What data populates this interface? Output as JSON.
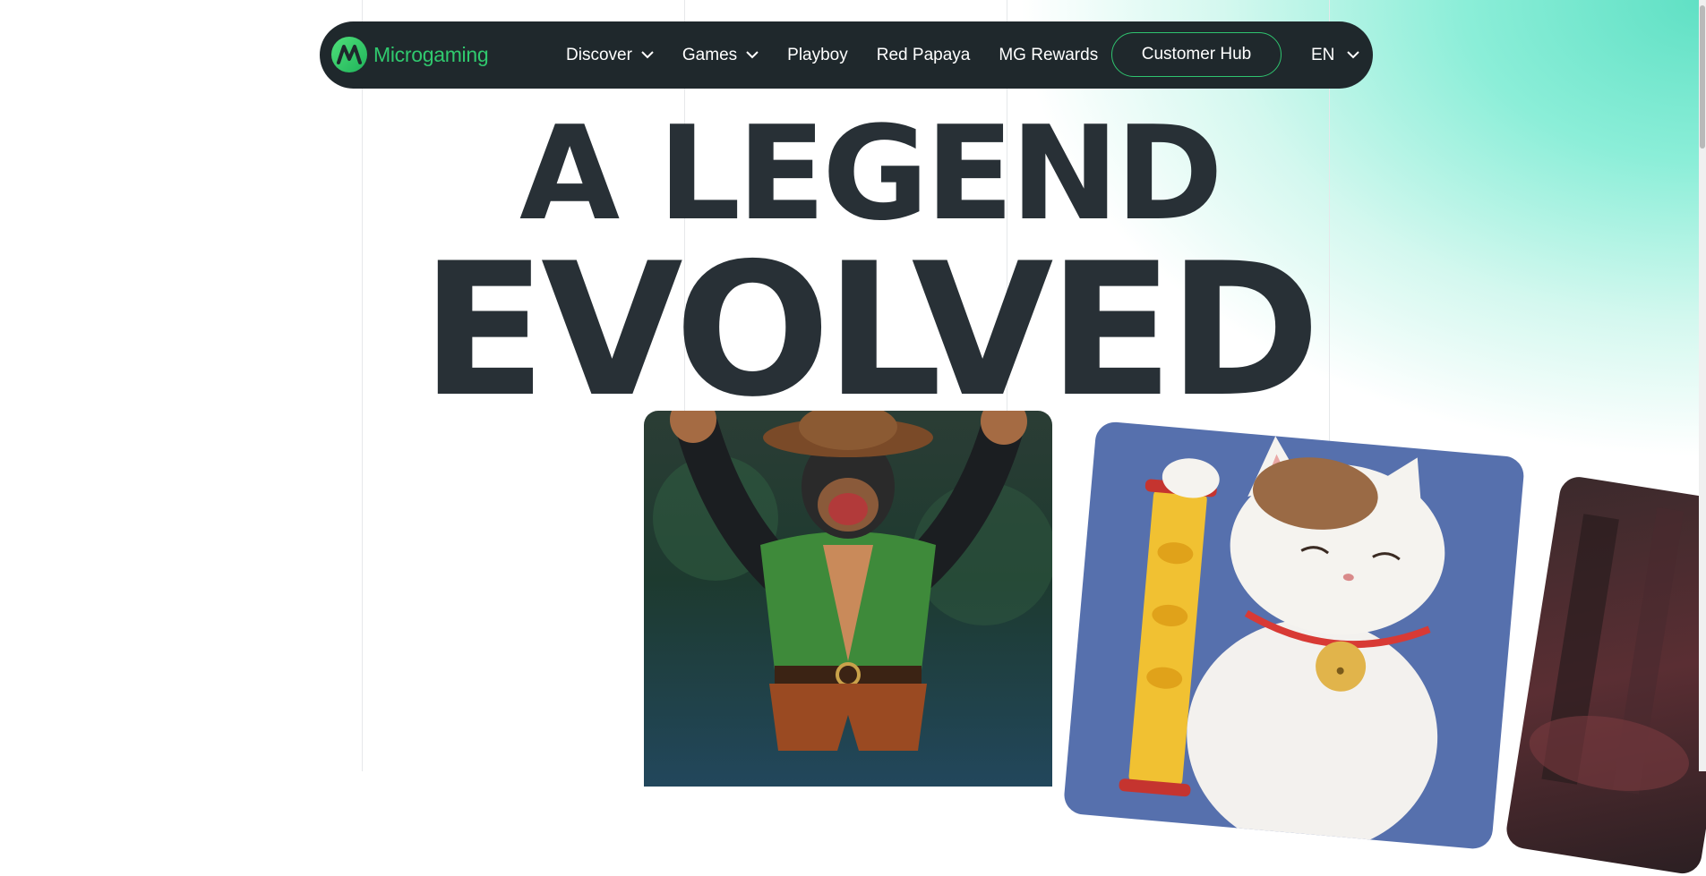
{
  "brand": {
    "name": "Microgaming",
    "logo_icon": "microgaming-m-logo"
  },
  "nav": {
    "items": [
      {
        "label": "Discover",
        "has_dropdown": true
      },
      {
        "label": "Games",
        "has_dropdown": true
      },
      {
        "label": "Playboy",
        "has_dropdown": false
      },
      {
        "label": "Red Papaya",
        "has_dropdown": false
      },
      {
        "label": "MG Rewards",
        "has_dropdown": false
      }
    ],
    "customer_hub_label": "Customer Hub",
    "language": "EN"
  },
  "hero": {
    "line1": "A LEGEND",
    "line2": "EVOLVED"
  },
  "colors": {
    "nav_bg": "#1f282c",
    "brand_green": "#30c96e",
    "headline": "#283036",
    "accent_mint": "#5fe0c4"
  }
}
